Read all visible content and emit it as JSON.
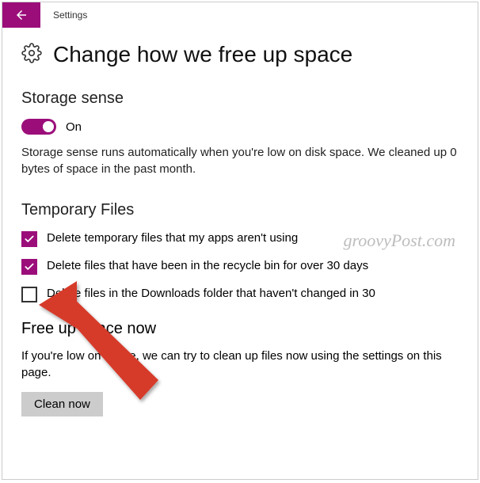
{
  "app_title": "Settings",
  "page_title": "Change how we free up space",
  "section1": {
    "title": "Storage sense",
    "toggle_state": "On",
    "desc": "Storage sense runs automatically when you're low on disk space. We cleaned up 0 bytes of space in the past month."
  },
  "section2": {
    "title": "Temporary Files",
    "items": [
      {
        "label": "Delete temporary files that my apps aren't using",
        "checked": true
      },
      {
        "label": "Delete files that have been in the recycle bin for over 30 days",
        "checked": true
      },
      {
        "label": "Delete files in the Downloads folder that haven't changed in 30",
        "checked": false
      }
    ]
  },
  "section3": {
    "title": "Free up space now",
    "desc": "If you're low on space, we can try to clean up files now using the settings on this page.",
    "button": "Clean now"
  },
  "watermark": "groovyPost.com"
}
